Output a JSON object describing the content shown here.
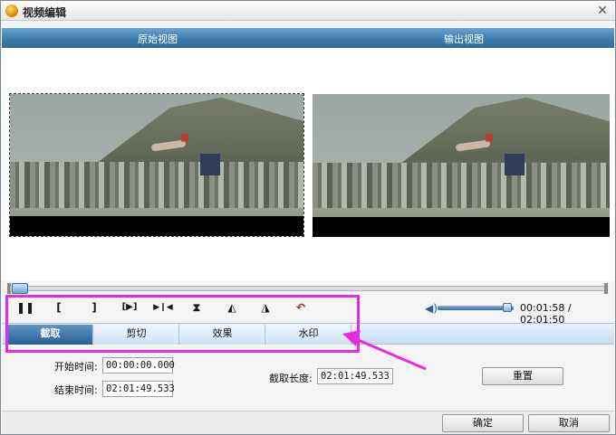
{
  "window": {
    "title": "视频编辑",
    "close_icon": "close-icon"
  },
  "views": {
    "original_label": "原始视图",
    "output_label": "输出视图"
  },
  "toolbar": {
    "buttons": [
      {
        "name": "pause-button",
        "glyph": "❚❚"
      },
      {
        "name": "set-start-button",
        "glyph": "["
      },
      {
        "name": "set-end-button",
        "glyph": "]"
      },
      {
        "name": "play-selection-button",
        "glyph": "[▶]"
      },
      {
        "name": "step-button",
        "glyph": "▶❙◀"
      },
      {
        "name": "flip-vertical-button",
        "glyph": "⧗"
      },
      {
        "name": "rotate-right-button",
        "glyph": "◭"
      },
      {
        "name": "rotate-left-button",
        "glyph": "◮"
      },
      {
        "name": "undo-button",
        "glyph": "↶"
      }
    ]
  },
  "playback": {
    "volume_fraction": 0.92,
    "time": "00:01:58 / 02:01:50",
    "seek_fraction": 0.01
  },
  "tabs": [
    {
      "label": "截取",
      "active": true
    },
    {
      "label": "剪切",
      "active": false
    },
    {
      "label": "效果",
      "active": false
    },
    {
      "label": "水印",
      "active": false
    }
  ],
  "trim": {
    "start_label": "开始时间:",
    "start_value": "00:00:00.000",
    "end_label": "结束时间:",
    "end_value": "02:01:49.533",
    "length_label": "截取长度:",
    "length_value": "02:01:49.533",
    "reset_label": "重置"
  },
  "footer": {
    "ok_label": "确定",
    "cancel_label": "取消"
  },
  "colors": {
    "header_blue": "#3e7bab",
    "annotation_magenta": "#e32ee0"
  }
}
